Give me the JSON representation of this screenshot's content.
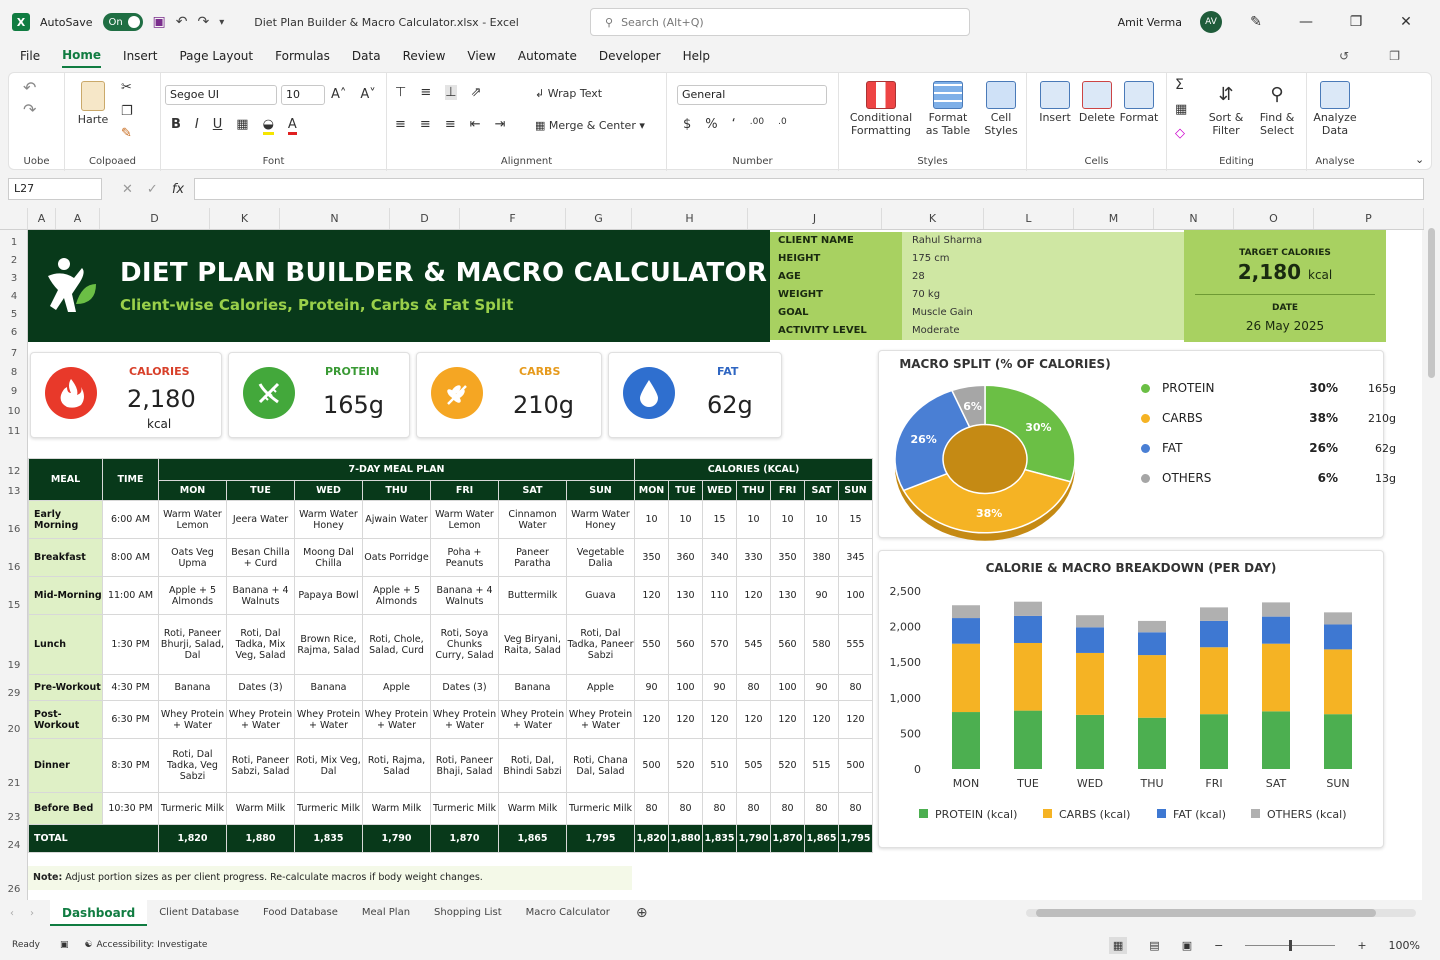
{
  "app": {
    "autosave_label": "AutoSave",
    "autosave_state": "On",
    "file_name": "Diet Plan Builder & Macro Calculator.xlsx",
    "app_name": "Excel",
    "search_placeholder": "Search (Alt+Q)",
    "user_name": "Amit Verma",
    "user_initials": "AV"
  },
  "menu": [
    "File",
    "Home",
    "Insert",
    "Page Layout",
    "Formulas",
    "Data",
    "Review",
    "View",
    "Automate",
    "Developer",
    "Help"
  ],
  "ribbon": {
    "groups": [
      "Uobe",
      "Colpoaed",
      "Font",
      "Alignment",
      "Number",
      "Styles",
      "Cells",
      "Editing",
      "Analyse"
    ],
    "paste_label": "Harte",
    "font_name": "Segoe UI",
    "font_size": "10",
    "wrap_text": "Wrap Text",
    "merge_center": "Merge & Center",
    "number_format": "General",
    "conditional_formatting": "Conditional Formatting",
    "format_as_table": "Format as Table",
    "cell_styles": "Cell Styles",
    "insert": "Insert",
    "delete": "Delete",
    "format": "Format",
    "sort_filter": "Sort & Filter",
    "find_select": "Find & Select",
    "analyze_data": "Analyze Data"
  },
  "formula_bar": {
    "name_box": "L27",
    "fx": "fx"
  },
  "columns": [
    "A",
    "A",
    "D",
    "K",
    "N",
    "D",
    "F",
    "G",
    "H",
    "J",
    "K",
    "L",
    "M",
    "N",
    "O",
    "P"
  ],
  "rows": [
    "1",
    "2",
    "3",
    "4",
    "5",
    "6",
    "7",
    "8",
    "9",
    "10",
    "11",
    "12",
    "13",
    "16",
    "16",
    "15",
    "19",
    "29",
    "20",
    "21",
    "23",
    "24",
    "26"
  ],
  "banner": {
    "title": "DIET PLAN BUILDER & MACRO CALCULATOR",
    "subtitle": "Client-wise Calories, Protein, Carbs & Fat Split"
  },
  "client": [
    {
      "k": "CLIENT NAME",
      "v": "Rahul Sharma"
    },
    {
      "k": "HEIGHT",
      "v": "175 cm"
    },
    {
      "k": "AGE",
      "v": "28"
    },
    {
      "k": "WEIGHT",
      "v": "70 kg"
    },
    {
      "k": "GOAL",
      "v": "Muscle Gain"
    },
    {
      "k": "ACTIVITY LEVEL",
      "v": "Moderate"
    }
  ],
  "target": {
    "label": "TARGET CALORIES",
    "value": "2,180",
    "unit": "kcal",
    "date_label": "DATE",
    "date_value": "26 May 2025"
  },
  "kpis": [
    {
      "label": "CALORIES",
      "value": "2,180",
      "unit": "kcal",
      "color": "#e8392a",
      "label_color": "#d8402a"
    },
    {
      "label": "PROTEIN",
      "value": "165g",
      "unit": "",
      "color": "#43a83b",
      "label_color": "#3a9a35"
    },
    {
      "label": "CARBS",
      "value": "210g",
      "unit": "",
      "color": "#f5a623",
      "label_color": "#e69a1c"
    },
    {
      "label": "FAT",
      "value": "62g",
      "unit": "",
      "color": "#2f6fcf",
      "label_color": "#2f66c2"
    }
  ],
  "meal_table": {
    "h_meal": "MEAL",
    "h_time": "TIME",
    "h_plan": "7-DAY MEAL PLAN",
    "h_cal": "CALORIES (KCAL)",
    "days": [
      "MON",
      "TUE",
      "WED",
      "THU",
      "FRI",
      "SAT",
      "SUN"
    ],
    "rows": [
      {
        "meal": "Early Morning",
        "time": "6:00 AM",
        "items": [
          "Warm Water Lemon",
          "Jeera Water",
          "Warm Water Honey",
          "Ajwain Water",
          "Warm Water Lemon",
          "Cinnamon Water",
          "Warm Water Honey"
        ],
        "cal": [
          "10",
          "10",
          "15",
          "10",
          "10",
          "10",
          "15"
        ]
      },
      {
        "meal": "Breakfast",
        "time": "8:00 AM",
        "items": [
          "Oats Veg Upma",
          "Besan Chilla + Curd",
          "Moong Dal Chilla",
          "Oats Porridge",
          "Poha + Peanuts",
          "Paneer Paratha",
          "Vegetable Dalia"
        ],
        "cal": [
          "350",
          "360",
          "340",
          "330",
          "350",
          "380",
          "345"
        ]
      },
      {
        "meal": "Mid-Morning",
        "time": "11:00 AM",
        "items": [
          "Apple + 5 Almonds",
          "Banana + 4 Walnuts",
          "Papaya Bowl",
          "Apple + 5 Almonds",
          "Banana + 4 Walnuts",
          "Buttermilk",
          "Guava"
        ],
        "cal": [
          "120",
          "130",
          "110",
          "120",
          "130",
          "90",
          "100"
        ]
      },
      {
        "meal": "Lunch",
        "time": "1:30 PM",
        "items": [
          "Roti, Paneer Bhurji, Salad, Dal",
          "Roti, Dal Tadka, Mix Veg, Salad",
          "Brown Rice, Rajma, Salad",
          "Roti, Chole, Salad, Curd",
          "Roti, Soya Chunks Curry, Salad",
          "Veg Biryani, Raita, Salad",
          "Roti, Dal Tadka, Paneer Sabzi"
        ],
        "cal": [
          "550",
          "560",
          "570",
          "545",
          "560",
          "580",
          "555"
        ]
      },
      {
        "meal": "Pre-Workout",
        "time": "4:30 PM",
        "items": [
          "Banana",
          "Dates (3)",
          "Banana",
          "Apple",
          "Dates (3)",
          "Banana",
          "Apple"
        ],
        "cal": [
          "90",
          "100",
          "90",
          "80",
          "100",
          "90",
          "80"
        ]
      },
      {
        "meal": "Post-Workout",
        "time": "6:30 PM",
        "items": [
          "Whey Protein + Water",
          "Whey Protein + Water",
          "Whey Protein + Water",
          "Whey Protein + Water",
          "Whey Protein + Water",
          "Whey Protein + Water",
          "Whey Protein + Water"
        ],
        "cal": [
          "120",
          "120",
          "120",
          "120",
          "120",
          "120",
          "120"
        ]
      },
      {
        "meal": "Dinner",
        "time": "8:30 PM",
        "items": [
          "Roti, Dal Tadka, Veg Sabzi",
          "Roti, Paneer Sabzi, Salad",
          "Roti, Mix Veg, Dal",
          "Roti, Rajma, Salad",
          "Roti, Paneer Bhaji, Salad",
          "Roti, Dal, Bhindi Sabzi",
          "Roti, Chana Dal, Salad"
        ],
        "cal": [
          "500",
          "520",
          "510",
          "505",
          "520",
          "515",
          "500"
        ]
      },
      {
        "meal": "Before Bed",
        "time": "10:30 PM",
        "items": [
          "Turmeric Milk",
          "Warm Milk",
          "Turmeric Milk",
          "Warm Milk",
          "Turmeric Milk",
          "Warm Milk",
          "Turmeric Milk"
        ],
        "cal": [
          "80",
          "80",
          "80",
          "80",
          "80",
          "80",
          "80"
        ]
      }
    ],
    "total_label": "TOTAL",
    "total_plan": [
      "1,820",
      "1,880",
      "1,835",
      "1,790",
      "1,870",
      "1,865",
      "1,795"
    ],
    "total_cal": [
      "1,820",
      "1,880",
      "1,835",
      "1,790",
      "1,870",
      "1,865",
      "1,795"
    ]
  },
  "note": {
    "label": "Note:",
    "text": "Adjust portion sizes as per client progress. Re-calculate macros if body weight changes."
  },
  "chart_data": [
    {
      "type": "pie",
      "title": "MACRO SPLIT (% OF CALORIES)",
      "labels": [
        "PROTEIN",
        "CARBS",
        "FAT",
        "OTHERS"
      ],
      "values": [
        30,
        38,
        26,
        6
      ],
      "value_labels": [
        "30%",
        "38%",
        "26%",
        "6%"
      ],
      "grams": [
        "165g",
        "210g",
        "62g",
        "13g"
      ],
      "colors": [
        "#6bbf45",
        "#f5b324",
        "#4a7fd4",
        "#a6a6a6"
      ],
      "legend": "right"
    },
    {
      "type": "bar",
      "stacked": true,
      "title": "CALORIE & MACRO BREAKDOWN (PER DAY)",
      "categories": [
        "MON",
        "TUE",
        "WED",
        "THU",
        "FRI",
        "SAT",
        "SUN"
      ],
      "yticks": [
        "0",
        "500",
        "1,000",
        "1,500",
        "2,000",
        "2,500"
      ],
      "ylim": [
        0,
        2500
      ],
      "series": [
        {
          "name": "PROTEIN (kcal)",
          "color": "#4caf50",
          "values": [
            800,
            820,
            760,
            720,
            770,
            810,
            770
          ]
        },
        {
          "name": "CARBS (kcal)",
          "color": "#f5b324",
          "values": [
            960,
            950,
            870,
            880,
            940,
            950,
            910
          ]
        },
        {
          "name": "FAT (kcal)",
          "color": "#3e78d2",
          "values": [
            360,
            380,
            360,
            320,
            370,
            380,
            350
          ]
        },
        {
          "name": "OTHERS (kcal)",
          "color": "#b0b0b0",
          "values": [
            180,
            200,
            170,
            160,
            190,
            200,
            170
          ]
        }
      ],
      "legend": "bottom",
      "grid": false
    }
  ],
  "tabs": [
    "Dashboard",
    "Client Database",
    "Food Database",
    "Meal Plan",
    "Shopping List",
    "Macro Calculator"
  ],
  "status": {
    "ready": "Ready",
    "accessibility": "Accessibility: Investigate",
    "zoom": "100%"
  }
}
